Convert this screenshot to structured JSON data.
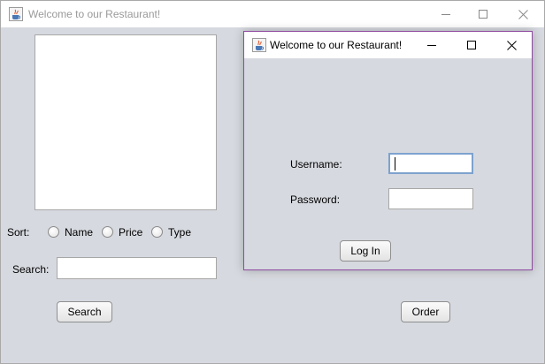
{
  "main_window": {
    "title": "Welcome to our Restaurant!",
    "sort": {
      "label": "Sort:",
      "options": [
        "Name",
        "Price",
        "Type"
      ]
    },
    "search": {
      "label": "Search:",
      "value": ""
    },
    "search_button": "Search",
    "order_button": "Order"
  },
  "login_dialog": {
    "title": "Welcome to our Restaurant!",
    "username_label": "Username:",
    "username_value": "",
    "password_label": "Password:",
    "password_value": "",
    "login_button": "Log In"
  },
  "icons": {
    "app": "java-cup-icon",
    "minimize": "minimize-icon",
    "maximize": "maximize-icon",
    "close": "close-icon"
  }
}
